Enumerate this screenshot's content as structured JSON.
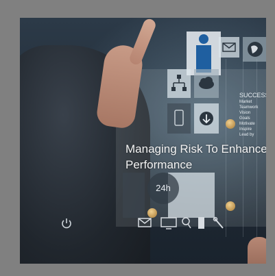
{
  "headline": {
    "line1": "Managing Risk To Enhance",
    "line2": "Performance"
  },
  "panel": {
    "title": "SUCCESS",
    "items": [
      "Market",
      "Teamwork",
      "Vision",
      "Goals",
      "Motivate",
      "Inspire",
      "Lead by"
    ]
  },
  "badge": {
    "text": "24h"
  },
  "icons": {
    "person": "person-icon",
    "mail": "mail-icon",
    "chart_flow": "org-chart-icon",
    "cloud": "cloud-icon",
    "phone": "phone-icon",
    "download": "download-icon",
    "power": "power-icon",
    "monitor": "monitor-icon",
    "tool": "tool-icon"
  },
  "colors": {
    "frame": "#808080",
    "accent": "#1f5fa0",
    "text": "#f4f4f4"
  }
}
